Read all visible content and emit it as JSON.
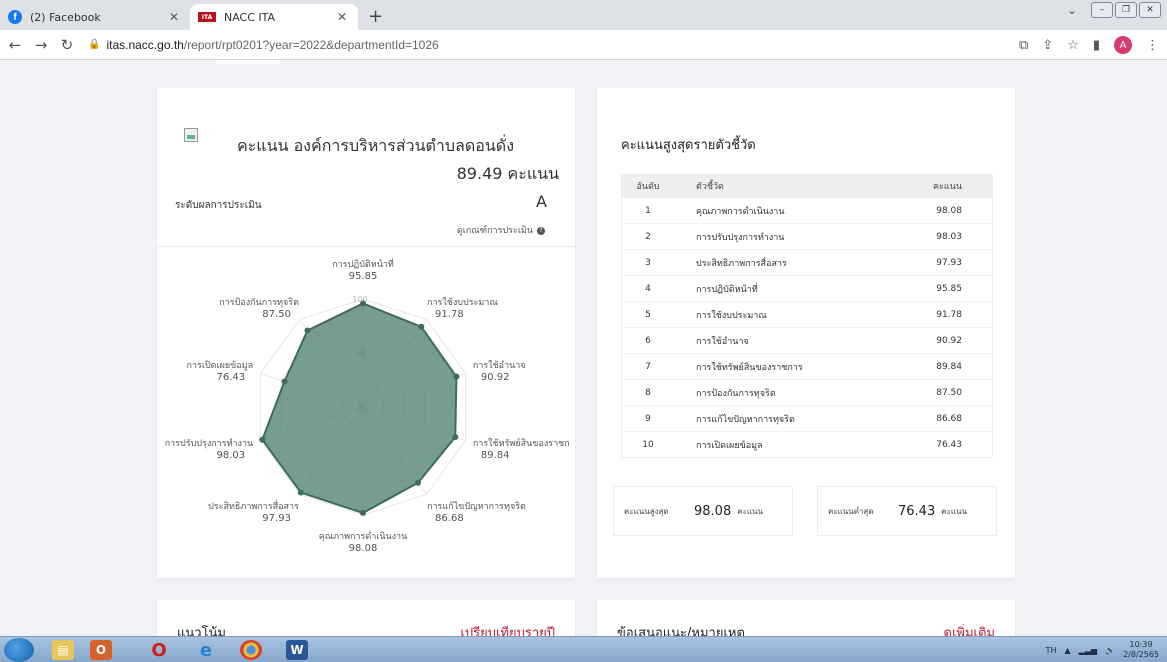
{
  "browser": {
    "tabs": [
      {
        "title": "(2) Facebook",
        "favicon": "f"
      },
      {
        "title": "NACC ITA",
        "favicon": "ITA"
      }
    ],
    "new_tab": "+",
    "url_host": "itas.nacc.go.th",
    "url_path": "/report/rpt0201?year=2022&departmentId=1026",
    "profile_initial": "A"
  },
  "score_card": {
    "title": "คะแนน องค์การบริหารส่วนตำบลดอนดั่ง",
    "score": "89.49 คะแนน",
    "level_label": "ระดับผลการประเมิน",
    "level": "A",
    "criteria_link": "ดูเกณฑ์การประเมิน"
  },
  "radar": {
    "color": "#4a7c6a",
    "ticks": [
      "0",
      "50",
      "100"
    ],
    "labels": [
      {
        "name": "การปฏิบัติหน้าที่",
        "value": "95.85"
      },
      {
        "name": "การใช้งบประมาณ",
        "value": "91.78"
      },
      {
        "name": "การใช้อำนาจ",
        "value": "90.92"
      },
      {
        "name": "การใช้ทรัพย์สินของราชก",
        "value": "89.84"
      },
      {
        "name": "การแก้ไขปัญหาการทุจริต",
        "value": "86.68"
      },
      {
        "name": "คุณภาพการดำเนินงาน",
        "value": "98.08"
      },
      {
        "name": "ประสิทธิภาพการสื่อสาร",
        "value": "97.93"
      },
      {
        "name": "การปรับปรุงการทำงาน",
        "value": "98.03"
      },
      {
        "name": "การเปิดเผยข้อมูล",
        "value": "76.43"
      },
      {
        "name": "การป้องกันการทุจริต",
        "value": "87.50"
      }
    ],
    "values": [
      95.85,
      91.78,
      90.92,
      89.84,
      86.68,
      98.08,
      97.93,
      98.03,
      76.43,
      87.5
    ]
  },
  "ranking": {
    "title": "คะแนนสูงสุดรายตัวชี้วัด",
    "headers": {
      "rank": "อันดับ",
      "indicator": "ตัวชี้วัด",
      "score": "คะแนน"
    },
    "rows": [
      {
        "rank": "1",
        "indicator": "คุณภาพการดำเนินงาน",
        "score": "98.08"
      },
      {
        "rank": "2",
        "indicator": "การปรับปรุงการทำงาน",
        "score": "98.03"
      },
      {
        "rank": "3",
        "indicator": "ประสิทธิภาพการสื่อสาร",
        "score": "97.93"
      },
      {
        "rank": "4",
        "indicator": "การปฏิบัติหน้าที่",
        "score": "95.85"
      },
      {
        "rank": "5",
        "indicator": "การใช้งบประมาณ",
        "score": "91.78"
      },
      {
        "rank": "6",
        "indicator": "การใช้อำนาจ",
        "score": "90.92"
      },
      {
        "rank": "7",
        "indicator": "การใช้ทรัพย์สินของราชการ",
        "score": "89.84"
      },
      {
        "rank": "8",
        "indicator": "การป้องกันการทุจริต",
        "score": "87.50"
      },
      {
        "rank": "9",
        "indicator": "การแก้ไขปัญหาการทุจริต",
        "score": "86.68"
      },
      {
        "rank": "10",
        "indicator": "การเปิดเผยข้อมูล",
        "score": "76.43"
      }
    ],
    "max_label": "คะแนนสูงสุด",
    "max_value": "98.08",
    "min_label": "คะแนนต่ำสุด",
    "min_value": "76.43",
    "unit": "คะแนน"
  },
  "bottom": {
    "left_title": "แนวโน้ม",
    "left_link": "เปรียบเทียบรายปี",
    "right_title": "ข้อเสนอแนะ/หมายเหตุ",
    "right_link": "ดูเพิ่มเติม"
  },
  "taskbar": {
    "lang": "TH",
    "time": "10:39",
    "date": "2/8/2565"
  }
}
